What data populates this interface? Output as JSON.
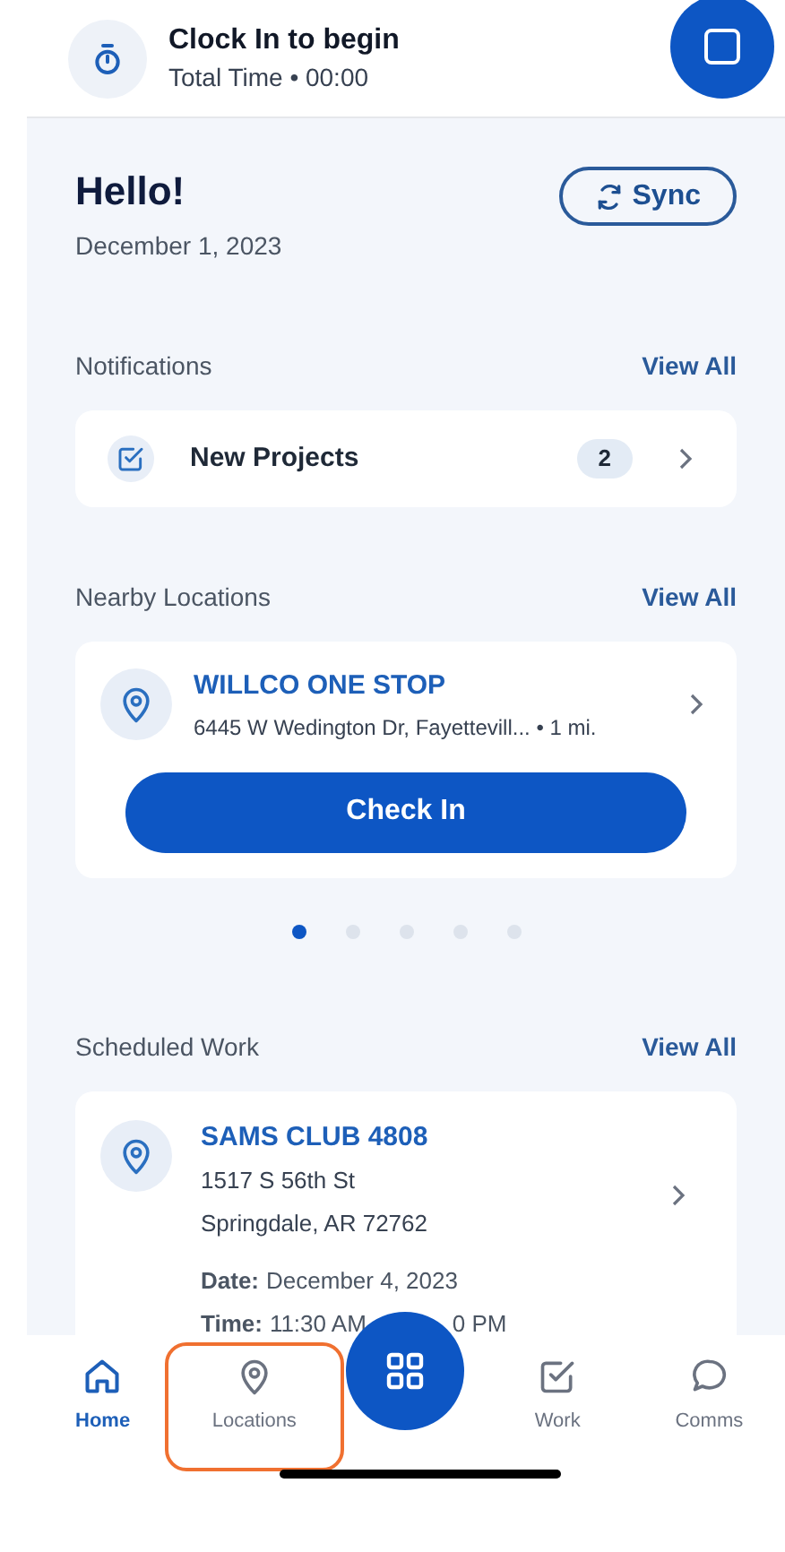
{
  "clock": {
    "title": "Clock In to begin",
    "subtitle": "Total Time • 00:00"
  },
  "greeting": {
    "title": "Hello!",
    "date": "December 1, 2023",
    "sync_button": "Sync"
  },
  "notifications": {
    "heading": "Notifications",
    "view_all": "View All",
    "items": [
      {
        "label": "New Projects",
        "count": "2"
      }
    ]
  },
  "nearby_locations": {
    "heading": "Nearby Locations",
    "view_all": "View All",
    "items": [
      {
        "name": "WILLCO ONE STOP",
        "address": "6445 W Wedington Dr, Fayettevill... • 1 mi.",
        "button": "Check In"
      }
    ],
    "pages": [
      {
        "selected": true
      },
      {
        "selected": false
      },
      {
        "selected": false
      },
      {
        "selected": false
      },
      {
        "selected": false
      }
    ]
  },
  "scheduled_work": {
    "heading": "Scheduled Work",
    "view_all": "View All",
    "items": [
      {
        "name": "SAMS CLUB 4808",
        "address_line_1": "1517 S 56th St",
        "address_line_2": "Springdale, AR 72762",
        "date_label": "Date:",
        "date": "December 4, 2023",
        "time_label": "Time:",
        "time_start": "11:30 AM",
        "time_end_partial": "0 PM"
      }
    ]
  },
  "tab_bar": {
    "items": [
      {
        "label": "Home",
        "kind": "home",
        "selected": true,
        "highlighted": false
      },
      {
        "label": "Locations",
        "kind": "locations",
        "selected": false,
        "highlighted": true
      },
      {
        "label": "Work",
        "kind": "work",
        "selected": false,
        "highlighted": false
      },
      {
        "label": "Comms",
        "kind": "comms",
        "selected": false,
        "highlighted": false
      }
    ]
  }
}
